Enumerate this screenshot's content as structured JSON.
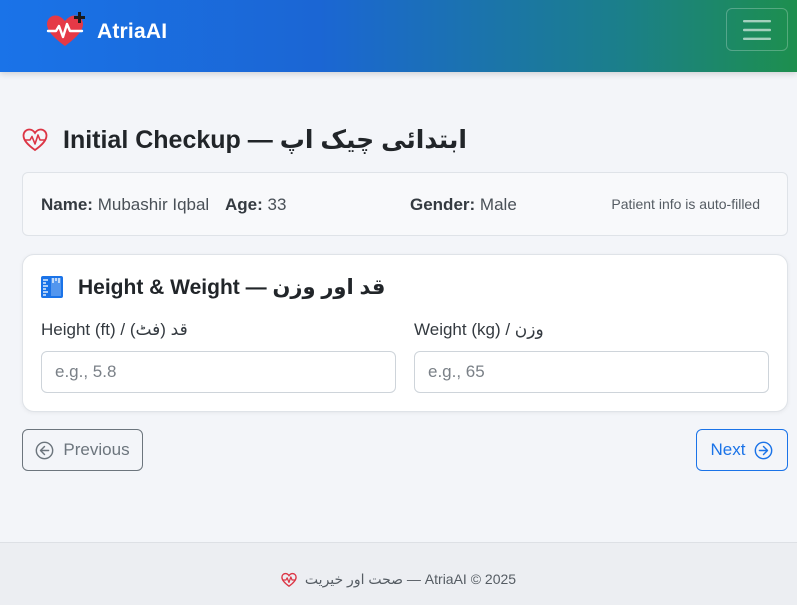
{
  "navbar": {
    "brand_name": "AtriaAI",
    "brand_icon": "heart-pulse-plus-icon",
    "menu_icon": "hamburger-menu-icon",
    "colors": {
      "gradient_start": "#1a73e8",
      "gradient_end": "#1d8f4e"
    }
  },
  "page": {
    "title": "Initial Checkup — ابتدائی چیک اپ",
    "title_icon": "heart-pulse-icon"
  },
  "patient_info": {
    "name_label": "Name:",
    "name_value": "Mubashir Iqbal",
    "age_label": "Age:",
    "age_value": "33",
    "gender_label": "Gender:",
    "gender_value": "Male",
    "note": "Patient info is auto-filled"
  },
  "measurements": {
    "section_title": "Height & Weight — قد اور وزن",
    "section_icon": "ruler-icon",
    "height": {
      "label": "Height (ft) / قد (فٹ)",
      "placeholder": "e.g., 5.8",
      "value": ""
    },
    "weight": {
      "label": "Weight (kg) / وزن",
      "placeholder": "e.g., 65",
      "value": ""
    }
  },
  "navigation": {
    "previous_label": "Previous",
    "previous_icon": "arrow-left-circle-icon",
    "next_label": "Next",
    "next_icon": "arrow-right-circle-icon"
  },
  "footer": {
    "text": "صحت اور خیریت — AtriaAI © 2025",
    "icon": "heart-pulse-icon"
  },
  "colors": {
    "accent": "#1a73e8",
    "heart_red": "#dc3545",
    "secondary": "#6c757d"
  }
}
